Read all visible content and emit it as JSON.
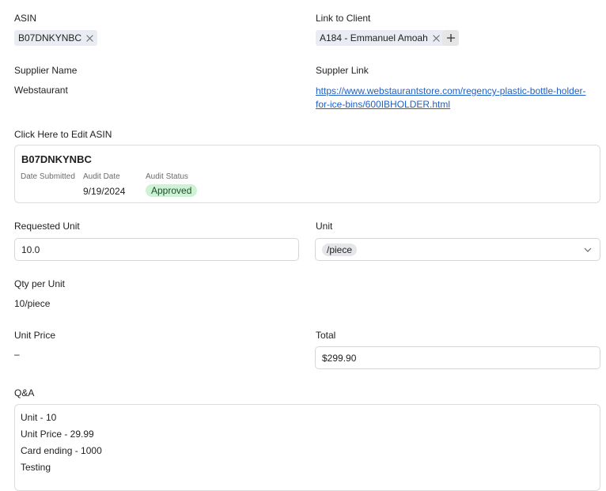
{
  "asin_field": {
    "label": "ASIN",
    "chip": "B07DNKYNBC"
  },
  "client_field": {
    "label": "Link to Client",
    "chip": "A184 - Emmanuel Amoah"
  },
  "supplier_name": {
    "label": "Supplier Name",
    "value": "Webstaurant"
  },
  "supplier_link": {
    "label": "Suppler Link",
    "line1": "https://www.webstaurantstore.com/regency-plastic-bottle-holder-",
    "line2": "for-ice-bins/600IBHOLDER.html"
  },
  "edit_asin": {
    "label": "Click Here to Edit ASIN",
    "title": "B07DNKYNBC",
    "date_submitted_label": "Date Submitted",
    "audit_date_label": "Audit Date",
    "audit_date_value": "9/19/2024",
    "audit_status_label": "Audit Status",
    "audit_status_value": "Approved"
  },
  "requested_unit": {
    "label": "Requested Unit",
    "value": "10.0"
  },
  "unit": {
    "label": "Unit",
    "value": "/piece"
  },
  "qty_per_unit": {
    "label": "Qty per Unit",
    "value": "10/piece"
  },
  "unit_price": {
    "label": "Unit Price",
    "value": "–"
  },
  "total": {
    "label": "Total",
    "value": "$299.90"
  },
  "qa": {
    "label": "Q&A",
    "lines": [
      "Unit - 10",
      "Unit Price - 29.99",
      "Card ending - 1000",
      "Testing"
    ]
  },
  "colors": {
    "link": "#1e5fc8",
    "approved_bg": "#cdf3d4",
    "chip_bg": "#e9edf3"
  }
}
